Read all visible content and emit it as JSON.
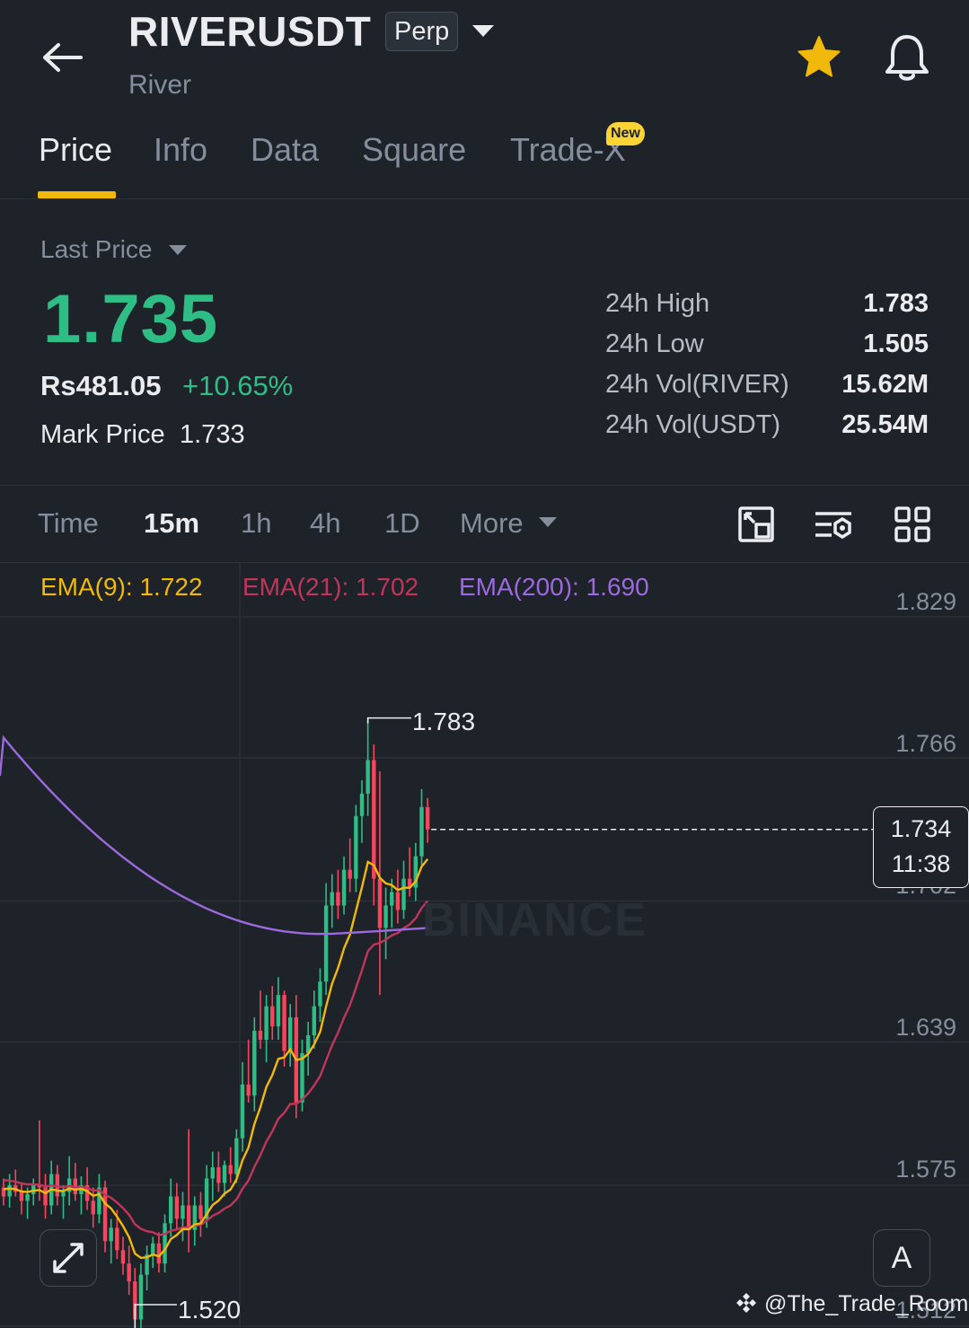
{
  "header": {
    "symbol": "RIVERUSDT",
    "contract_type": "Perp",
    "name": "River",
    "icons": [
      "back-arrow-icon",
      "chevron-down-icon",
      "star-icon",
      "bell-icon"
    ],
    "star_color": "#f0b90b"
  },
  "tabs": [
    {
      "label": "Price",
      "active": true
    },
    {
      "label": "Info"
    },
    {
      "label": "Data"
    },
    {
      "label": "Square"
    },
    {
      "label": "Trade-X",
      "badge": "New"
    }
  ],
  "price": {
    "label": "Last Price",
    "last": "1.735",
    "local": "Rs481.05",
    "change": "+10.65%",
    "mark_label": "Mark Price",
    "mark_value": "1.733",
    "up_color": "#2ebd85",
    "down_color": "#f6465d"
  },
  "stats": [
    {
      "label": "24h High",
      "value": "1.783"
    },
    {
      "label": "24h Low",
      "value": "1.505"
    },
    {
      "label": "24h Vol(RIVER)",
      "value": "15.62M"
    },
    {
      "label": "24h Vol(USDT)",
      "value": "25.54M"
    }
  ],
  "intervals": {
    "items": [
      {
        "label": "Time"
      },
      {
        "label": "15m",
        "active": true
      },
      {
        "label": "1h"
      },
      {
        "label": "4h"
      },
      {
        "label": "1D"
      },
      {
        "label": "More"
      }
    ],
    "tools": [
      "chart-settings-icon",
      "indicator-icon",
      "grid-layout-icon"
    ]
  },
  "ema": [
    {
      "label": "EMA(9): 1.722",
      "color": "#f0b90b"
    },
    {
      "label": "EMA(21): 1.702",
      "color": "#c0365b"
    },
    {
      "label": "EMA(200): 1.690",
      "color": "#9c6ade"
    }
  ],
  "chart": {
    "axis_labels": [
      "1.829",
      "1.766",
      "1.702",
      "1.639",
      "1.575",
      "1.512"
    ],
    "current_price": "1.734",
    "countdown": "11:38",
    "high_label": "1.783",
    "low_label": "1.520",
    "watermark": "BINANCE",
    "auto_label": "A",
    "credit": "@The_Trade_Room"
  },
  "chart_data": {
    "type": "candlestick",
    "interval": "15m",
    "y_axis_ticks": [
      1.829,
      1.766,
      1.702,
      1.639,
      1.575,
      1.512
    ],
    "current_price": 1.734,
    "marked_high": 1.783,
    "marked_low": 1.52,
    "candles": [
      [
        1.574,
        1.578,
        1.566,
        1.57
      ],
      [
        1.57,
        1.58,
        1.565,
        1.575
      ],
      [
        1.575,
        1.582,
        1.57,
        1.572
      ],
      [
        1.572,
        1.576,
        1.562,
        1.568
      ],
      [
        1.568,
        1.574,
        1.56,
        1.571
      ],
      [
        1.571,
        1.578,
        1.566,
        1.575
      ],
      [
        1.575,
        1.604,
        1.568,
        1.574
      ],
      [
        1.574,
        1.58,
        1.56,
        1.566
      ],
      [
        1.566,
        1.586,
        1.562,
        1.58
      ],
      [
        1.58,
        1.584,
        1.566,
        1.57
      ],
      [
        1.57,
        1.575,
        1.56,
        1.572
      ],
      [
        1.572,
        1.588,
        1.566,
        1.578
      ],
      [
        1.578,
        1.585,
        1.568,
        1.571
      ],
      [
        1.571,
        1.579,
        1.562,
        1.575
      ],
      [
        1.575,
        1.583,
        1.564,
        1.568
      ],
      [
        1.568,
        1.574,
        1.556,
        1.562
      ],
      [
        1.562,
        1.58,
        1.558,
        1.574
      ],
      [
        1.574,
        1.577,
        1.545,
        1.55
      ],
      [
        1.55,
        1.56,
        1.54,
        1.556
      ],
      [
        1.556,
        1.564,
        1.542,
        1.546
      ],
      [
        1.546,
        1.552,
        1.535,
        1.54
      ],
      [
        1.54,
        1.548,
        1.526,
        1.532
      ],
      [
        1.532,
        1.538,
        1.508,
        1.515
      ],
      [
        1.515,
        1.54,
        1.505,
        1.535
      ],
      [
        1.535,
        1.548,
        1.528,
        1.544
      ],
      [
        1.544,
        1.552,
        1.538,
        1.549
      ],
      [
        1.549,
        1.554,
        1.536,
        1.54
      ],
      [
        1.54,
        1.562,
        1.536,
        1.558
      ],
      [
        1.558,
        1.578,
        1.552,
        1.57
      ],
      [
        1.57,
        1.576,
        1.555,
        1.56
      ],
      [
        1.56,
        1.572,
        1.55,
        1.566
      ],
      [
        1.566,
        1.6,
        1.545,
        1.555
      ],
      [
        1.555,
        1.57,
        1.548,
        1.566
      ],
      [
        1.566,
        1.572,
        1.552,
        1.56
      ],
      [
        1.56,
        1.584,
        1.556,
        1.578
      ],
      [
        1.578,
        1.59,
        1.568,
        1.583
      ],
      [
        1.583,
        1.59,
        1.572,
        1.576
      ],
      [
        1.576,
        1.586,
        1.57,
        1.584
      ],
      [
        1.584,
        1.592,
        1.576,
        1.58
      ],
      [
        1.58,
        1.6,
        1.576,
        1.596
      ],
      [
        1.596,
        1.63,
        1.59,
        1.62
      ],
      [
        1.62,
        1.64,
        1.612,
        1.615
      ],
      [
        1.615,
        1.65,
        1.608,
        1.644
      ],
      [
        1.644,
        1.662,
        1.636,
        1.64
      ],
      [
        1.64,
        1.66,
        1.63,
        1.655
      ],
      [
        1.655,
        1.664,
        1.64,
        1.646
      ],
      [
        1.646,
        1.668,
        1.64,
        1.66
      ],
      [
        1.66,
        1.662,
        1.628,
        1.635
      ],
      [
        1.635,
        1.656,
        1.628,
        1.65
      ],
      [
        1.65,
        1.66,
        1.605,
        1.612
      ],
      [
        1.612,
        1.64,
        1.608,
        1.634
      ],
      [
        1.634,
        1.648,
        1.624,
        1.642
      ],
      [
        1.642,
        1.662,
        1.636,
        1.655
      ],
      [
        1.655,
        1.672,
        1.648,
        1.666
      ],
      [
        1.666,
        1.71,
        1.66,
        1.7
      ],
      [
        1.7,
        1.714,
        1.69,
        1.706
      ],
      [
        1.706,
        1.716,
        1.694,
        1.7
      ],
      [
        1.7,
        1.722,
        1.696,
        1.716
      ],
      [
        1.716,
        1.73,
        1.706,
        1.712
      ],
      [
        1.712,
        1.745,
        1.706,
        1.74
      ],
      [
        1.74,
        1.756,
        1.728,
        1.75
      ],
      [
        1.75,
        1.783,
        1.74,
        1.765
      ],
      [
        1.765,
        1.772,
        1.7,
        1.712
      ],
      [
        1.712,
        1.76,
        1.66,
        1.69
      ],
      [
        1.69,
        1.708,
        1.676,
        1.7
      ],
      [
        1.7,
        1.712,
        1.69,
        1.706
      ],
      [
        1.706,
        1.716,
        1.692,
        1.698
      ],
      [
        1.698,
        1.72,
        1.694,
        1.712
      ],
      [
        1.712,
        1.726,
        1.704,
        1.708
      ],
      [
        1.708,
        1.728,
        1.702,
        1.722
      ],
      [
        1.722,
        1.752,
        1.718,
        1.744
      ],
      [
        1.744,
        1.748,
        1.728,
        1.734
      ]
    ]
  }
}
